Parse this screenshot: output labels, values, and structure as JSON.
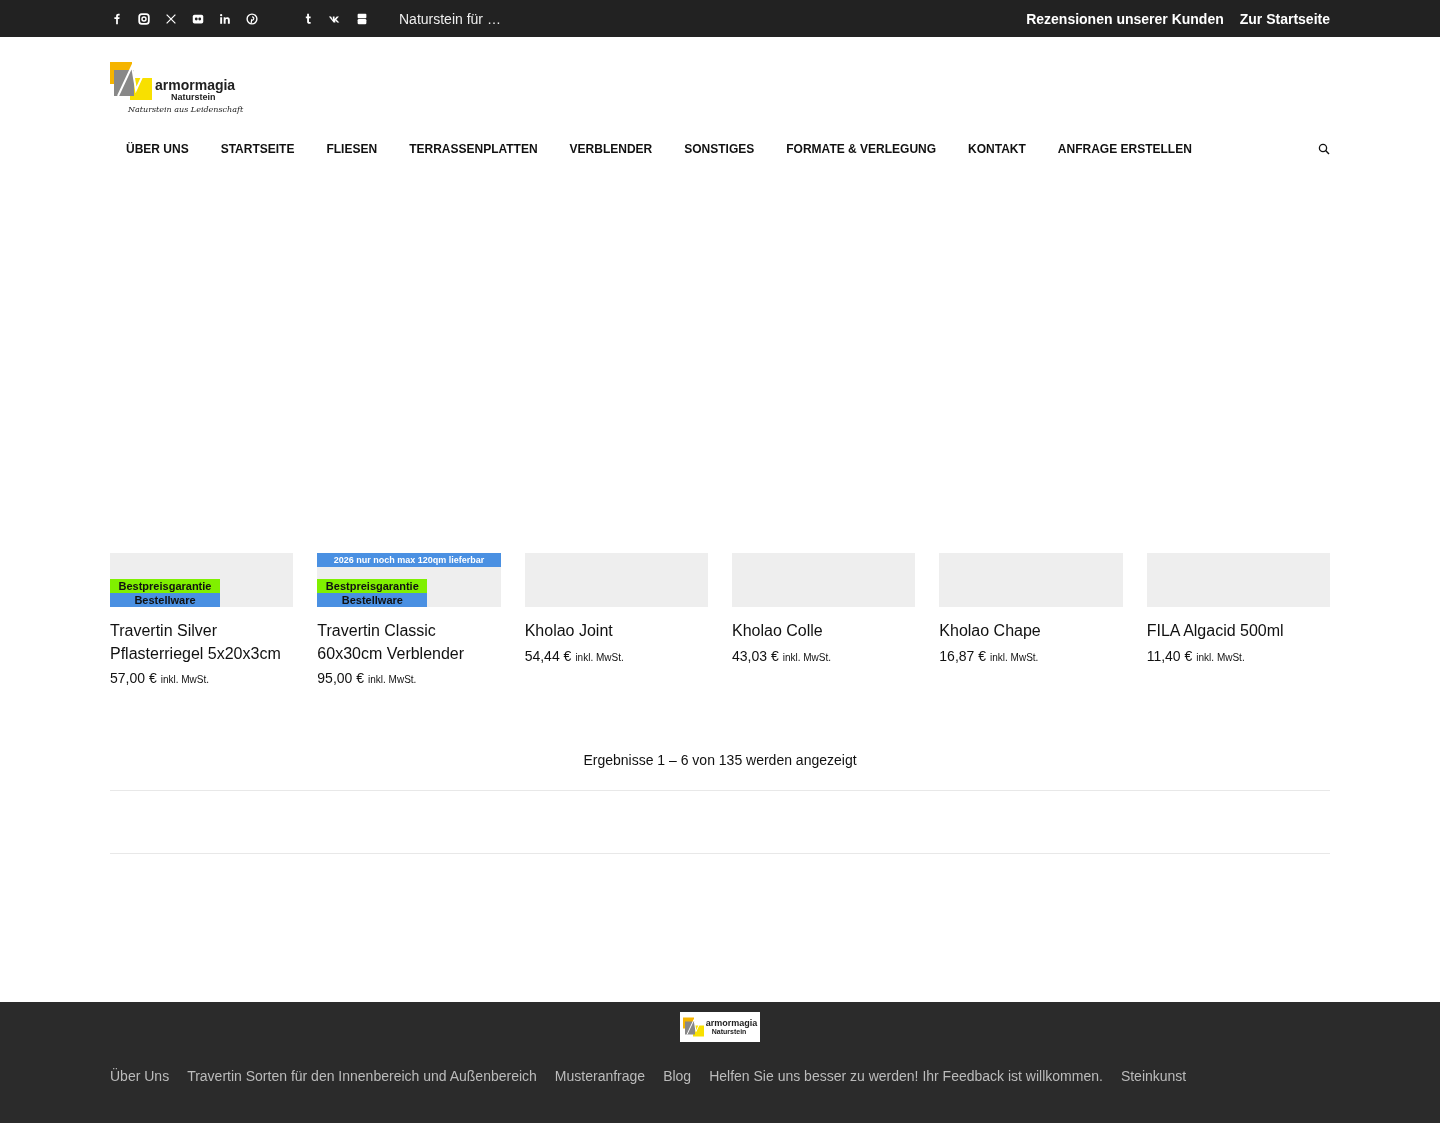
{
  "top_bar": {
    "ticker": "Naturstein für …",
    "links": [
      "Rezensionen unserer Kunden",
      "Zur Startseite"
    ]
  },
  "logo": {
    "name": "armormagia",
    "subtitle": "Naturstein",
    "tagline": "Naturstein aus Leidenschaft"
  },
  "nav": {
    "items": [
      "ÜBER UNS",
      "STARTSEITE",
      "FLIESEN",
      "TERRASSENPLATTEN",
      "VERBLENDER",
      "SONSTIGES",
      "FORMATE & VERLEGUNG",
      "KONTAKT",
      "ANFRAGE ERSTELLEN"
    ]
  },
  "products": [
    {
      "badges": [
        {
          "kind": "label",
          "text": "Bestpreisgarantie",
          "color": "#80f000"
        },
        {
          "kind": "label",
          "text": "Bestellware",
          "color": "#4a90e2"
        }
      ],
      "title": "Travertin Silver Pflasterriegel 5x20x3cm",
      "price": "57,00 €",
      "tax": "inkl. MwSt."
    },
    {
      "badges": [
        {
          "kind": "banner",
          "text": "2026 nur noch max 120qm lieferbar",
          "color": "#4a90e2"
        },
        {
          "kind": "label",
          "text": "Bestpreisgarantie",
          "color": "#80f000"
        },
        {
          "kind": "label",
          "text": "Bestellware",
          "color": "#4a90e2"
        }
      ],
      "title": "Travertin Classic 60x30cm Verblender",
      "price": "95,00 €",
      "tax": "inkl. MwSt."
    },
    {
      "title": "Kholao Joint",
      "price": "54,44 €",
      "tax": "inkl. MwSt."
    },
    {
      "title": "Kholao Colle",
      "price": "43,03 €",
      "tax": "inkl. MwSt."
    },
    {
      "title": "Kholao Chape",
      "price": "16,87 €",
      "tax": "inkl. MwSt."
    },
    {
      "title": "FILA Algacid 500ml",
      "price": "11,40 €",
      "tax": "inkl. MwSt."
    }
  ],
  "result_count": "Ergebnisse 1 – 6 von 135 werden angezeigt",
  "footer": {
    "logo": {
      "name": "armormagia",
      "subtitle": "Naturstein"
    },
    "links": [
      "Über Uns",
      "Travertin Sorten für den Innenbereich und Außenbereich",
      "Musteranfrage",
      "Blog",
      "Helfen Sie uns besser zu werden! Ihr Feedback ist willkommen.",
      "Steinkunst"
    ]
  }
}
